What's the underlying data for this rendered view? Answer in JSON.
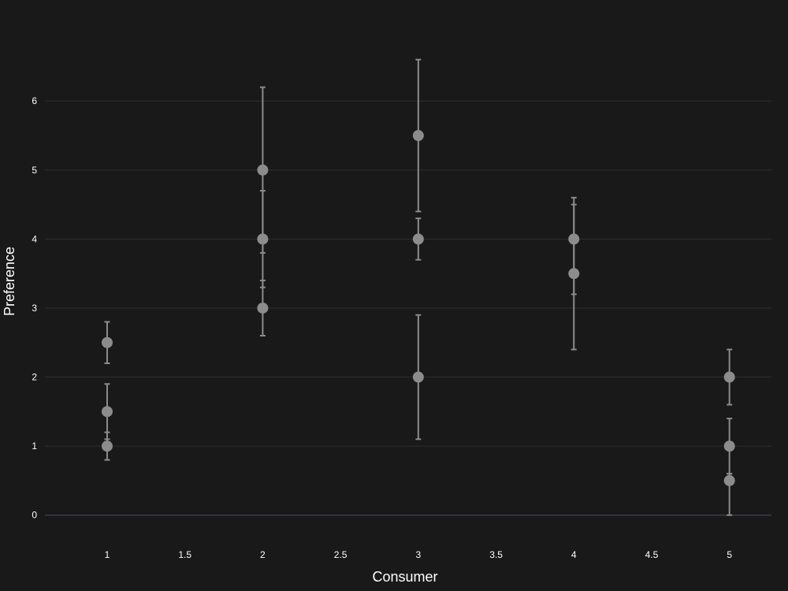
{
  "chart_data": {
    "type": "scatter",
    "title": "",
    "xlabel": "Consumer",
    "ylabel": "Preference",
    "xlim": [
      0.6,
      5.27
    ],
    "ylim": [
      -0.3,
      6.95
    ],
    "x_ticks": [
      1,
      1.5,
      2,
      2.5,
      3,
      3.5,
      4,
      4.5,
      5
    ],
    "x_tick_labels": [
      "1",
      "1.5",
      "2",
      "2.5",
      "3",
      "3.5",
      "4",
      "4.5",
      "5"
    ],
    "y_ticks": [
      0,
      1,
      2,
      3,
      4,
      5,
      6
    ],
    "y_tick_labels": [
      "0",
      "1",
      "2",
      "3",
      "4",
      "5",
      "6"
    ],
    "grid": "horizontal",
    "marker_color": "#8c8c8c",
    "background": "#191919",
    "points": [
      {
        "x": 1,
        "y": 2.5,
        "err_low": 0.3,
        "err_high": 0.3
      },
      {
        "x": 1,
        "y": 1.5,
        "err_low": 0.4,
        "err_high": 0.4
      },
      {
        "x": 1,
        "y": 1.0,
        "err_low": 0.2,
        "err_high": 0.2
      },
      {
        "x": 2,
        "y": 5.0,
        "err_low": 1.2,
        "err_high": 1.2
      },
      {
        "x": 2,
        "y": 4.0,
        "err_low": 0.7,
        "err_high": 0.7
      },
      {
        "x": 2,
        "y": 3.0,
        "err_low": 0.4,
        "err_high": 0.4
      },
      {
        "x": 3,
        "y": 5.5,
        "err_low": 1.1,
        "err_high": 1.1
      },
      {
        "x": 3,
        "y": 4.0,
        "err_low": 0.3,
        "err_high": 0.3
      },
      {
        "x": 3,
        "y": 2.0,
        "err_low": 0.9,
        "err_high": 0.9
      },
      {
        "x": 4,
        "y": 4.0,
        "err_low": 0.8,
        "err_high": 0.6
      },
      {
        "x": 4,
        "y": 3.5,
        "err_low": 1.1,
        "err_high": 1.0
      },
      {
        "x": 5,
        "y": 2.0,
        "err_low": 0.4,
        "err_high": 0.4
      },
      {
        "x": 5,
        "y": 1.0,
        "err_low": 0.4,
        "err_high": 0.4
      },
      {
        "x": 5,
        "y": 0.5,
        "err_low": 0.5,
        "err_high": 0.1
      }
    ]
  }
}
